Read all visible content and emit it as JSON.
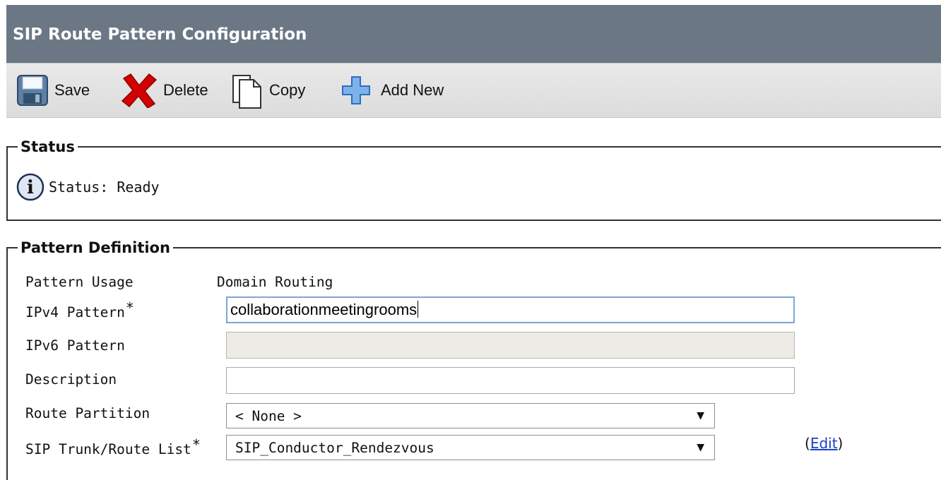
{
  "header": {
    "title": "SIP Route Pattern Configuration"
  },
  "toolbar": {
    "save_label": "Save",
    "delete_label": "Delete",
    "copy_label": "Copy",
    "add_new_label": "Add New"
  },
  "status": {
    "legend": "Status",
    "text": "Status: Ready",
    "icon": "info-icon"
  },
  "pattern_definition": {
    "legend": "Pattern Definition",
    "usage": {
      "label": "Pattern Usage",
      "value": "Domain Routing"
    },
    "ipv4": {
      "label": "IPv4 Pattern",
      "required": "*",
      "value": "collaborationmeetingrooms"
    },
    "ipv6": {
      "label": "IPv6 Pattern",
      "value": ""
    },
    "description": {
      "label": "Description",
      "value": ""
    },
    "route_partition": {
      "label": "Route Partition",
      "value": "< None >"
    },
    "sip_trunk": {
      "label": "SIP Trunk/Route List",
      "required": "*",
      "value": "SIP_Conductor_Rendezvous"
    },
    "edit": {
      "open": "(",
      "link": "Edit",
      "close": ")"
    }
  },
  "colors": {
    "title_bar": "#6b7785",
    "toolbar": "#e2e2e2",
    "link": "#1a3ec8",
    "delete_x": "#d40000",
    "add_plus": "#4a8fd8"
  }
}
